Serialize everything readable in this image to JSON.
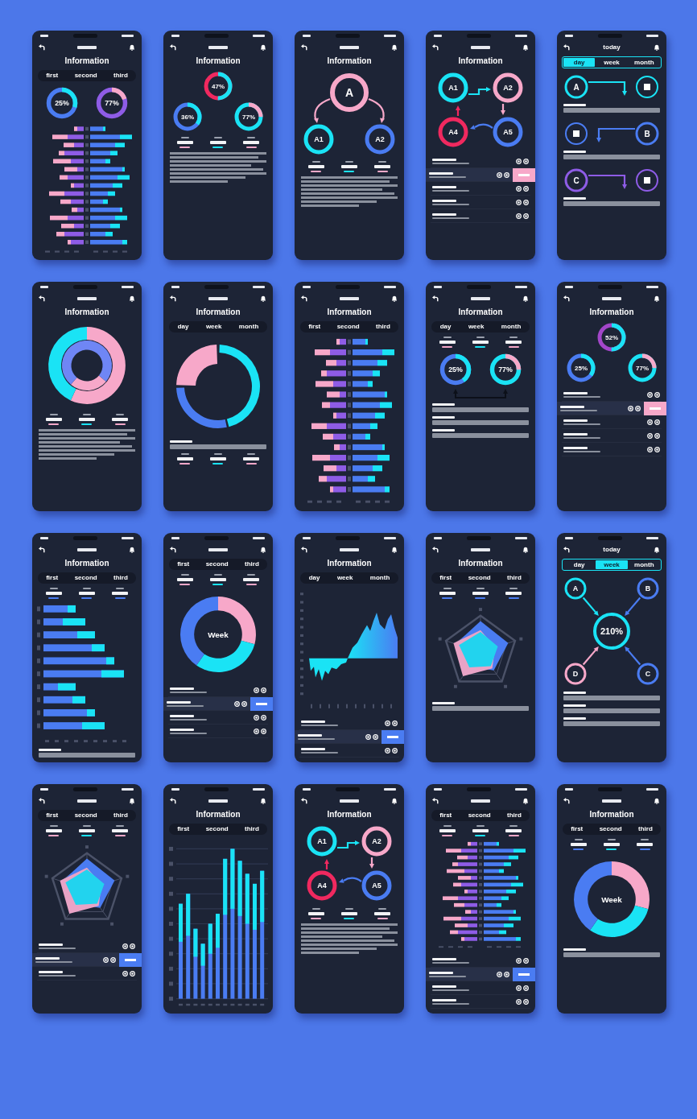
{
  "phones": [
    {
      "blocks": [
        {
          "kind": "heading",
          "text": "Information"
        },
        {
          "kind": "tabs",
          "items": [
            {
              "label": "first",
              "selected": false
            },
            {
              "label": "second",
              "selected": false
            },
            {
              "label": "third",
              "selected": false
            }
          ]
        },
        {
          "kind": "ring-pair",
          "items": [
            {
              "label": "25%",
              "color": "#4a7cf2",
              "arc": {
                "level": 0.3,
                "color": "#1ae3f5"
              }
            },
            {
              "label": "77%",
              "color": "#8e5ce6",
              "arc": {
                "level": 0.2,
                "color": "#f7a8c9"
              }
            }
          ]
        },
        {
          "kind": "butterfly-chart"
        }
      ]
    },
    {
      "blocks": [
        {
          "kind": "heading",
          "text": "Information"
        },
        {
          "kind": "ring-triangle",
          "items": [
            {
              "label": "47%",
              "color": "#f0295f",
              "arc": {
                "level": 0.5,
                "color": "#1ae3f5"
              }
            },
            {
              "label": "36%",
              "color": "#4a7cf2",
              "arc": {
                "level": 0.35,
                "color": "#1ae3f5"
              }
            },
            {
              "label": "77%",
              "color": "#1ae3f5",
              "arc": {
                "level": 0.25,
                "color": "#f7a8c9"
              }
            }
          ]
        },
        {
          "kind": "stats",
          "items": [
            {
              "color": "#f7a8c9"
            },
            {
              "color": "#1ae3f5"
            },
            {
              "color": "#f7a8c9"
            }
          ]
        },
        {
          "kind": "paragraph"
        }
      ]
    },
    {
      "blocks": [
        {
          "kind": "heading",
          "text": "Information"
        },
        {
          "kind": "tree",
          "root": {
            "label": "A",
            "color": "#f7a8c9"
          },
          "children": [
            {
              "label": "A1",
              "color": "#1ae3f5"
            },
            {
              "label": "A2",
              "color": "#4a7cf2"
            }
          ]
        },
        {
          "kind": "stats",
          "items": [
            {
              "color": "#f7a8c9"
            },
            {
              "color": "#1ae3f5"
            },
            {
              "color": "#f7a8c9"
            }
          ]
        },
        {
          "kind": "paragraph"
        }
      ]
    },
    {
      "blocks": [
        {
          "kind": "heading",
          "text": "Information"
        },
        {
          "kind": "cycle",
          "nodes": [
            {
              "label": "A1",
              "color": "#1ae3f5"
            },
            {
              "label": "A2",
              "color": "#f7a8c9"
            },
            {
              "label": "A4",
              "color": "#f0295f"
            },
            {
              "label": "A5",
              "color": "#4a7cf2"
            }
          ]
        },
        {
          "kind": "list",
          "rows": [
            {
              "kind": "plain"
            },
            {
              "kind": "swiped",
              "color": "#f7a8c9"
            },
            {
              "kind": "plain"
            },
            {
              "kind": "plain"
            },
            {
              "kind": "plain"
            }
          ]
        }
      ]
    },
    {
      "title": "today",
      "blocks": [
        {
          "kind": "outline-tabs",
          "items": [
            {
              "label": "day",
              "selected": true
            },
            {
              "label": "week",
              "selected": false
            },
            {
              "label": "month",
              "selected": false
            }
          ]
        },
        {
          "kind": "flow",
          "rows": [
            {
              "kind": "label-left",
              "label": "A",
              "color": "#1ae3f5"
            },
            {
              "kind": "label-right",
              "label": "B",
              "color": "#4a7cf2"
            },
            {
              "kind": "label-left",
              "label": "C",
              "color": "#8e5ce6"
            }
          ]
        }
      ]
    },
    {
      "blocks": [
        {
          "kind": "heading",
          "text": "Information"
        },
        {
          "kind": "double-donut-chart"
        },
        {
          "kind": "stats",
          "items": [
            {
              "color": "#f7a8c9"
            },
            {
              "color": "#1ae3f5"
            },
            {
              "color": "#f7a8c9"
            }
          ]
        },
        {
          "kind": "paragraph"
        }
      ]
    },
    {
      "blocks": [
        {
          "kind": "heading",
          "text": "Information"
        },
        {
          "kind": "tabs",
          "items": [
            {
              "label": "day",
              "selected": false
            },
            {
              "label": "week",
              "selected": false
            },
            {
              "label": "month",
              "selected": false
            }
          ]
        },
        {
          "kind": "ring-chart"
        },
        {
          "kind": "caption"
        },
        {
          "kind": "stats",
          "items": [
            {
              "color": "#f7a8c9"
            },
            {
              "color": "#1ae3f5"
            },
            {
              "color": "#f7a8c9"
            }
          ]
        }
      ]
    },
    {
      "blocks": [
        {
          "kind": "heading",
          "text": "Information"
        },
        {
          "kind": "tabs",
          "items": [
            {
              "label": "first",
              "selected": false
            },
            {
              "label": "second",
              "selected": false
            },
            {
              "label": "third",
              "selected": false
            }
          ]
        },
        {
          "kind": "butterfly-chart"
        }
      ]
    },
    {
      "blocks": [
        {
          "kind": "heading",
          "text": "Information"
        },
        {
          "kind": "tabs",
          "items": [
            {
              "label": "day",
              "selected": false
            },
            {
              "label": "week",
              "selected": false
            },
            {
              "label": "month",
              "selected": false
            }
          ]
        },
        {
          "kind": "stats",
          "items": [
            {
              "color": "#f7a8c9"
            },
            {
              "color": "#1ae3f5"
            },
            {
              "color": "#f7a8c9"
            }
          ]
        },
        {
          "kind": "linked-rings",
          "items": [
            {
              "label": "25%",
              "color": "#4a7cf2",
              "arc": {
                "level": 0.4,
                "color": "#1ae3f5"
              }
            },
            {
              "label": "77%",
              "color": "#1ae3f5",
              "arc": {
                "level": 0.25,
                "color": "#f7a8c9"
              }
            }
          ]
        },
        {
          "kind": "caption"
        },
        {
          "kind": "caption"
        },
        {
          "kind": "caption"
        }
      ]
    },
    {
      "blocks": [
        {
          "kind": "heading",
          "text": "Information"
        },
        {
          "kind": "ring-triangle",
          "items": [
            {
              "label": "52%",
              "color": "#a246c9",
              "arc": {
                "level": 0.5,
                "color": "#1ae3f5"
              }
            },
            {
              "label": "25%",
              "color": "#4a7cf2",
              "arc": {
                "level": 0.35,
                "color": "#1ae3f5"
              }
            },
            {
              "label": "77%",
              "color": "#1ae3f5",
              "arc": {
                "level": 0.25,
                "color": "#f7a8c9"
              }
            }
          ]
        },
        {
          "kind": "list",
          "rows": [
            {
              "kind": "plain"
            },
            {
              "kind": "swiped",
              "color": "#f7a8c9"
            },
            {
              "kind": "plain"
            },
            {
              "kind": "plain"
            },
            {
              "kind": "plain"
            }
          ]
        }
      ]
    },
    {
      "blocks": [
        {
          "kind": "heading",
          "text": "Information"
        },
        {
          "kind": "tabs",
          "items": [
            {
              "label": "first",
              "selected": false
            },
            {
              "label": "second",
              "selected": false
            },
            {
              "label": "third",
              "selected": false
            }
          ]
        },
        {
          "kind": "stats",
          "items": [
            {
              "color": "#4a7cf2"
            },
            {
              "color": "#4a7cf2"
            },
            {
              "color": "#4a7cf2"
            }
          ]
        },
        {
          "kind": "hbar-chart"
        },
        {
          "kind": "caption"
        }
      ]
    },
    {
      "blocks": [
        {
          "kind": "tabs",
          "items": [
            {
              "label": "first",
              "selected": false
            },
            {
              "label": "second",
              "selected": false
            },
            {
              "label": "third",
              "selected": false
            }
          ]
        },
        {
          "kind": "stats",
          "items": [
            {
              "color": "#f7a8c9"
            },
            {
              "color": "#1ae3f5"
            },
            {
              "color": "#f7a8c9"
            }
          ]
        },
        {
          "kind": "donut-chart",
          "label": "Week"
        },
        {
          "kind": "list",
          "rows": [
            {
              "kind": "plain"
            },
            {
              "kind": "swiped",
              "color": "#4a7cf2"
            },
            {
              "kind": "plain"
            },
            {
              "kind": "plain"
            }
          ]
        }
      ]
    },
    {
      "blocks": [
        {
          "kind": "heading",
          "text": "Information"
        },
        {
          "kind": "tabs",
          "items": [
            {
              "label": "day",
              "selected": false
            },
            {
              "label": "week",
              "selected": false
            },
            {
              "label": "month",
              "selected": false
            }
          ]
        },
        {
          "kind": "area-chart"
        },
        {
          "kind": "list",
          "rows": [
            {
              "kind": "plain"
            },
            {
              "kind": "swiped",
              "color": "#4a7cf2"
            },
            {
              "kind": "plain"
            }
          ]
        }
      ]
    },
    {
      "blocks": [
        {
          "kind": "heading",
          "text": "Information"
        },
        {
          "kind": "tabs",
          "items": [
            {
              "label": "first",
              "selected": false
            },
            {
              "label": "second",
              "selected": false
            },
            {
              "label": "third",
              "selected": false
            }
          ]
        },
        {
          "kind": "stats",
          "items": [
            {
              "color": "#4a7cf2"
            },
            {
              "color": "#4a7cf2"
            },
            {
              "color": "#4a7cf2"
            }
          ]
        },
        {
          "kind": "radar-chart"
        },
        {
          "kind": "caption"
        }
      ]
    },
    {
      "title": "today",
      "blocks": [
        {
          "kind": "outline-tabs",
          "items": [
            {
              "label": "day",
              "selected": false
            },
            {
              "label": "week",
              "selected": true
            },
            {
              "label": "month",
              "selected": false
            }
          ]
        },
        {
          "kind": "hub",
          "center": {
            "label": "210%",
            "color": "#1ae3f5"
          },
          "nodes": [
            {
              "label": "A",
              "color": "#1ae3f5"
            },
            {
              "label": "B",
              "color": "#4a7cf2"
            },
            {
              "label": "D",
              "color": "#f7a8c9"
            },
            {
              "label": "C",
              "color": "#4a7cf2"
            }
          ]
        },
        {
          "kind": "caption"
        },
        {
          "kind": "caption"
        },
        {
          "kind": "caption"
        }
      ]
    },
    {
      "blocks": [
        {
          "kind": "tabs",
          "items": [
            {
              "label": "first",
              "selected": false
            },
            {
              "label": "second",
              "selected": false
            },
            {
              "label": "third",
              "selected": false
            }
          ]
        },
        {
          "kind": "stats",
          "items": [
            {
              "color": "#f7a8c9"
            },
            {
              "color": "#1ae3f5"
            },
            {
              "color": "#f7a8c9"
            }
          ]
        },
        {
          "kind": "radar-chart"
        },
        {
          "kind": "list",
          "rows": [
            {
              "kind": "plain"
            },
            {
              "kind": "swiped",
              "color": "#4a7cf2"
            },
            {
              "kind": "plain"
            }
          ]
        }
      ]
    },
    {
      "blocks": [
        {
          "kind": "heading",
          "text": "Information"
        },
        {
          "kind": "tabs",
          "items": [
            {
              "label": "first",
              "selected": false
            },
            {
              "label": "second",
              "selected": false
            },
            {
              "label": "third",
              "selected": false
            }
          ]
        },
        {
          "kind": "vbar-chart"
        }
      ]
    },
    {
      "blocks": [
        {
          "kind": "heading",
          "text": "Information"
        },
        {
          "kind": "cycle",
          "nodes": [
            {
              "label": "A1",
              "color": "#1ae3f5"
            },
            {
              "label": "A2",
              "color": "#f7a8c9"
            },
            {
              "label": "A4",
              "color": "#f0295f"
            },
            {
              "label": "A5",
              "color": "#4a7cf2"
            }
          ]
        },
        {
          "kind": "stats",
          "items": [
            {
              "color": "#f7a8c9"
            },
            {
              "color": "#1ae3f5"
            },
            {
              "color": "#f7a8c9"
            }
          ]
        },
        {
          "kind": "paragraph"
        }
      ]
    },
    {
      "blocks": [
        {
          "kind": "tabs",
          "items": [
            {
              "label": "first",
              "selected": false
            },
            {
              "label": "second",
              "selected": false
            },
            {
              "label": "third",
              "selected": false
            }
          ]
        },
        {
          "kind": "stats",
          "items": [
            {
              "color": "#f7a8c9"
            },
            {
              "color": "#1ae3f5"
            },
            {
              "color": "#f7a8c9"
            }
          ]
        },
        {
          "kind": "butterfly-chart"
        },
        {
          "kind": "list",
          "rows": [
            {
              "kind": "plain"
            },
            {
              "kind": "swiped",
              "color": "#4a7cf2"
            },
            {
              "kind": "plain"
            },
            {
              "kind": "plain"
            }
          ]
        }
      ]
    },
    {
      "blocks": [
        {
          "kind": "heading",
          "text": "Information"
        },
        {
          "kind": "tabs",
          "items": [
            {
              "label": "first",
              "selected": false
            },
            {
              "label": "second",
              "selected": false
            },
            {
              "label": "third",
              "selected": false
            }
          ]
        },
        {
          "kind": "stats",
          "items": [
            {
              "color": "#4a7cf2"
            },
            {
              "color": "#1ae3f5"
            },
            {
              "color": "#4a7cf2"
            }
          ]
        },
        {
          "kind": "donut-chart",
          "label": "Week"
        },
        {
          "kind": "caption"
        }
      ]
    }
  ]
}
